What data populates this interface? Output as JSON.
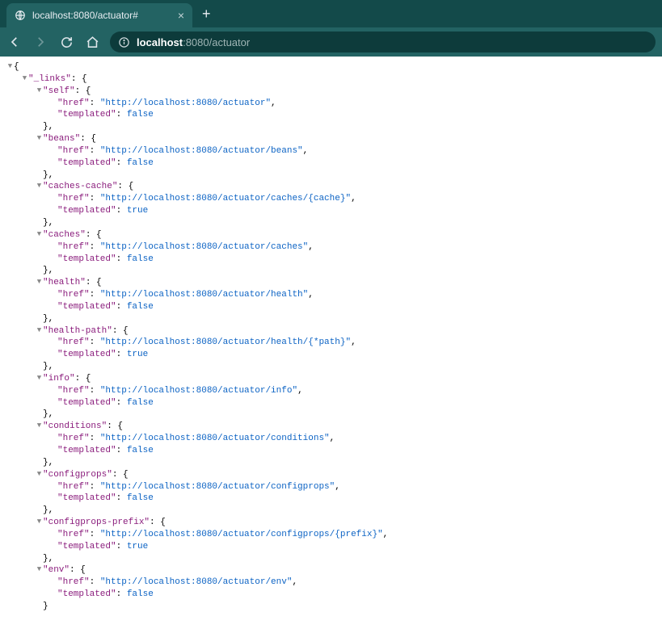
{
  "browser": {
    "tab_title": "localhost:8080/actuator#",
    "url_host": "localhost",
    "url_path": ":8080/actuator"
  },
  "json": {
    "root_key": "_links",
    "entries": [
      {
        "key": "self",
        "href": "http://localhost:8080/actuator",
        "templated": false
      },
      {
        "key": "beans",
        "href": "http://localhost:8080/actuator/beans",
        "templated": false
      },
      {
        "key": "caches-cache",
        "href": "http://localhost:8080/actuator/caches/{cache}",
        "templated": true
      },
      {
        "key": "caches",
        "href": "http://localhost:8080/actuator/caches",
        "templated": false
      },
      {
        "key": "health",
        "href": "http://localhost:8080/actuator/health",
        "templated": false
      },
      {
        "key": "health-path",
        "href": "http://localhost:8080/actuator/health/{*path}",
        "templated": true
      },
      {
        "key": "info",
        "href": "http://localhost:8080/actuator/info",
        "templated": false
      },
      {
        "key": "conditions",
        "href": "http://localhost:8080/actuator/conditions",
        "templated": false
      },
      {
        "key": "configprops",
        "href": "http://localhost:8080/actuator/configprops",
        "templated": false
      },
      {
        "key": "configprops-prefix",
        "href": "http://localhost:8080/actuator/configprops/{prefix}",
        "templated": true
      },
      {
        "key": "env",
        "href": "http://localhost:8080/actuator/env",
        "templated": false
      }
    ],
    "labels": {
      "href": "href",
      "templated": "templated",
      "true": "true",
      "false": "false"
    }
  }
}
